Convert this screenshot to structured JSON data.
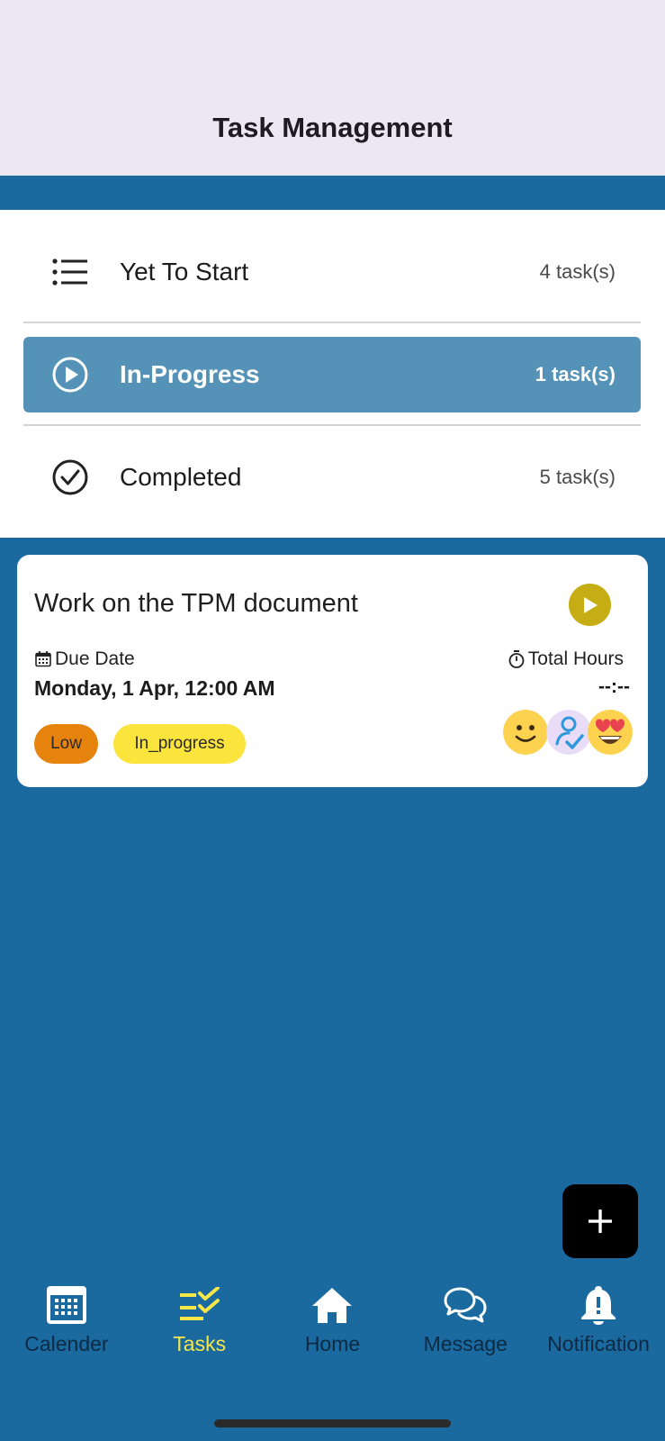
{
  "header": {
    "title": "Task Management"
  },
  "status_rows": [
    {
      "label": "Yet To Start",
      "count": "4 task(s)",
      "icon": "list-icon",
      "selected": false
    },
    {
      "label": "In-Progress",
      "count": "1 task(s)",
      "icon": "play-circle-icon",
      "selected": true
    },
    {
      "label": "Completed",
      "count": "5 task(s)",
      "icon": "check-circle-icon",
      "selected": false
    }
  ],
  "task": {
    "title": "Work on the TPM document",
    "due_label": "Due Date",
    "due_value": "Monday, 1 Apr, 12:00 AM",
    "hours_label": "Total Hours",
    "hours_value": "--:--",
    "priority_tag": "Low",
    "status_tag": "In_progress",
    "avatars": [
      "smiley-emoji-avatar",
      "user-check-avatar",
      "heart-eyes-emoji-avatar"
    ]
  },
  "fab": {
    "icon": "plus-icon"
  },
  "nav": {
    "items": [
      {
        "label": "Calender",
        "icon": "calendar-icon",
        "active": false
      },
      {
        "label": "Tasks",
        "icon": "tasks-icon",
        "active": true
      },
      {
        "label": "Home",
        "icon": "home-icon",
        "active": false
      },
      {
        "label": "Message",
        "icon": "message-icon",
        "active": false
      },
      {
        "label": "Notification",
        "icon": "bell-icon",
        "active": false
      }
    ]
  },
  "colors": {
    "background": "#1a6aa0",
    "header": "#ebe8f3",
    "selected_row": "#5592b8",
    "priority_low": "#e6830c",
    "status_in_progress": "#fbe53d",
    "play_button": "#c5ad13",
    "nav_active": "#f5e64a"
  }
}
